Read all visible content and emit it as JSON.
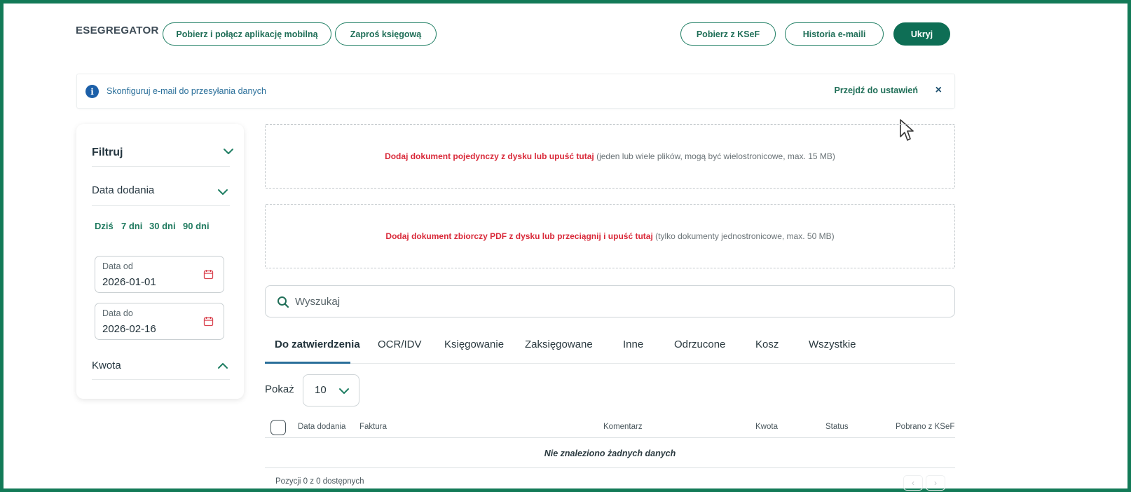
{
  "header": {
    "brand": "ESEGREGATOR",
    "buttons": {
      "mobile_app": "Pobierz i połącz aplikację mobilną",
      "invite_accountant": "Zaproś księgową",
      "download_ksef": "Pobierz z KSeF",
      "email_history": "Historia e-maili",
      "hide": "Ukryj"
    }
  },
  "banner": {
    "icon": "info-icon",
    "message": "Skonfiguruj e-mail do przesyłania danych",
    "link": "Przejdź do ustawień",
    "close": "×"
  },
  "filters": {
    "title": "Filtruj",
    "date_added": {
      "label": "Data dodania",
      "quick": [
        "Dziś",
        "7 dni",
        "30 dni",
        "90 dni"
      ],
      "from": {
        "label": "Data od",
        "value": "2026-01-01"
      },
      "to": {
        "label": "Data do",
        "value": "2026-02-16"
      }
    },
    "amount": {
      "label": "Kwota"
    }
  },
  "upload": {
    "single": {
      "action": "Dodaj dokument pojedynczy z dysku lub upuść tutaj",
      "hint": " (jeden lub wiele plików, mogą być wielostronicowe, max. 15 MB)"
    },
    "batch": {
      "action": "Dodaj dokument zbiorczy PDF z dysku lub przeciągnij i upuść tutaj",
      "hint": " (tylko dokumenty jednostronicowe, max. 50 MB)"
    }
  },
  "search": {
    "placeholder": "Wyszukaj"
  },
  "tabs": [
    "Do zatwierdzenia",
    "OCR/IDV",
    "Księgowanie",
    "Zaksięgowane",
    "Inne",
    "Odrzucone",
    "Kosz",
    "Wszystkie"
  ],
  "active_tab": "Do zatwierdzenia",
  "page_size": {
    "label": "Pokaż",
    "value": "10"
  },
  "table": {
    "columns": [
      "Data dodania",
      "Faktura",
      "Komentarz",
      "Kwota",
      "Status",
      "Pobrano z KSeF"
    ],
    "empty": "Nie znaleziono żadnych danych",
    "footer": "Pozycji 0 z 0 dostępnych",
    "pager": {
      "prev": "‹",
      "next": "›"
    }
  },
  "colors": {
    "frame": "#137a57",
    "accent": "#0e6e55",
    "link": "#1f6e57",
    "upload_action": "#d92a3a",
    "tab_underline": "#2a6f9a"
  }
}
